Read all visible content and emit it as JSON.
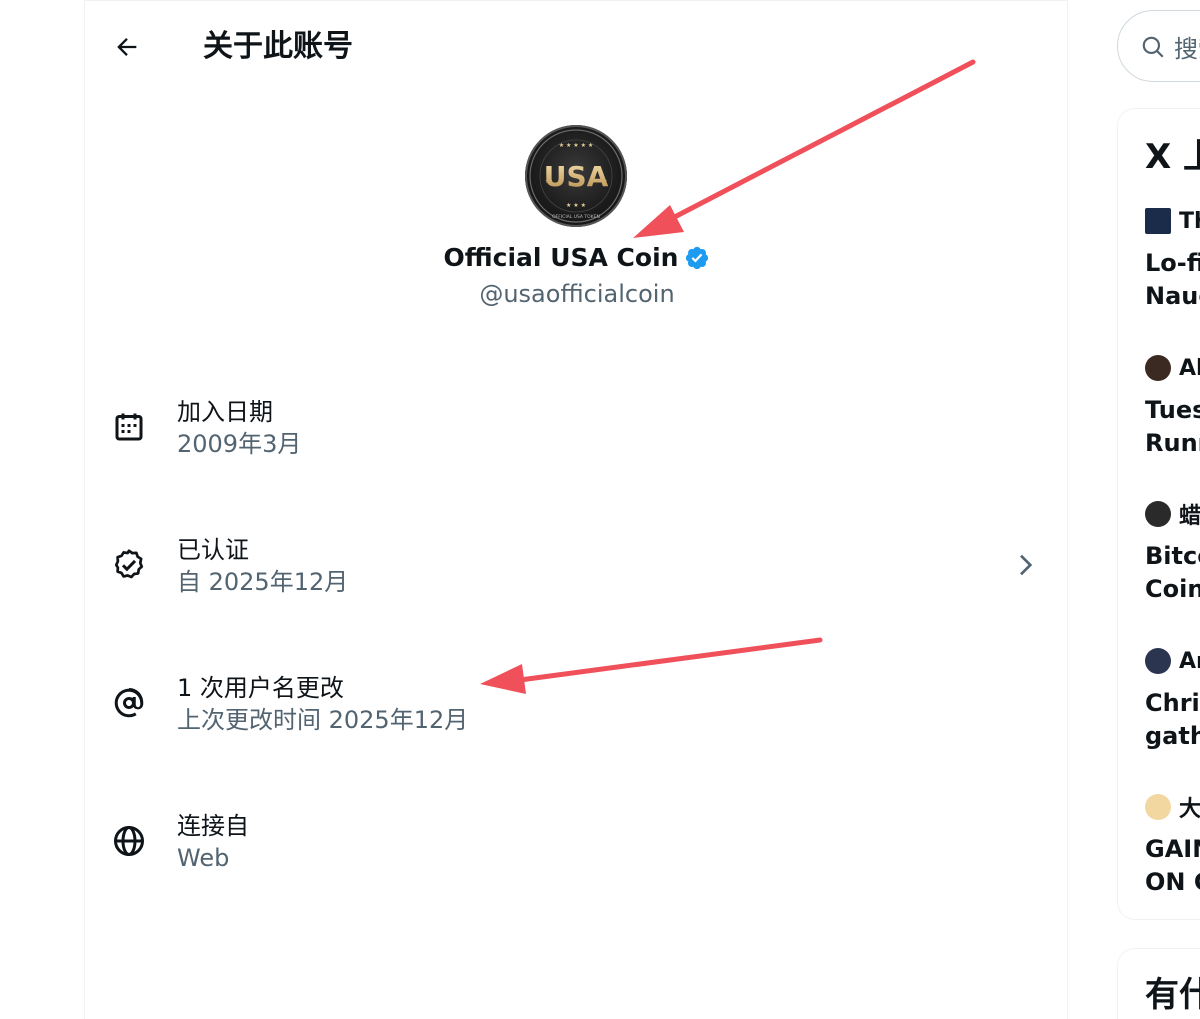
{
  "header": {
    "title": "关于此账号"
  },
  "profile": {
    "avatar_text": "USA",
    "avatar_ring_text": "OFFICIAL USA TOKEN",
    "display_name": "Official USA Coin",
    "handle": "@usaofficialcoin"
  },
  "info_items": [
    {
      "icon": "calendar-icon",
      "label": "加入日期",
      "sub": "2009年3月"
    },
    {
      "icon": "verified-badge-icon",
      "label": "已认证",
      "sub": "自 2025年12月"
    },
    {
      "icon": "at-sign-icon",
      "label": "1 次用户名更改",
      "sub": "上次更改时间 2025年12月"
    },
    {
      "icon": "globe-icon",
      "label": "连接自",
      "sub": "Web"
    }
  ],
  "colors": {
    "annotation_arrow": "#f0505a",
    "verified_blue": "#1d9bf0",
    "secondary_text": "#536471"
  },
  "sidebar": {
    "search_placeholder": "搜索",
    "trending_title": "X 上",
    "trends": [
      {
        "source": "Th",
        "line1": "Lo-fi",
        "line2": "Naug"
      },
      {
        "source": "Al",
        "line1": "Tues",
        "line2": "Runn"
      },
      {
        "source": "蜡",
        "line1": "Bitco",
        "line2": "Coin"
      },
      {
        "source": "Ar",
        "line1": "Chris",
        "line2": "gathe"
      },
      {
        "source": "大",
        "line1": "GAIN",
        "line2": "ON G"
      }
    ],
    "bottom_title": "有什"
  }
}
